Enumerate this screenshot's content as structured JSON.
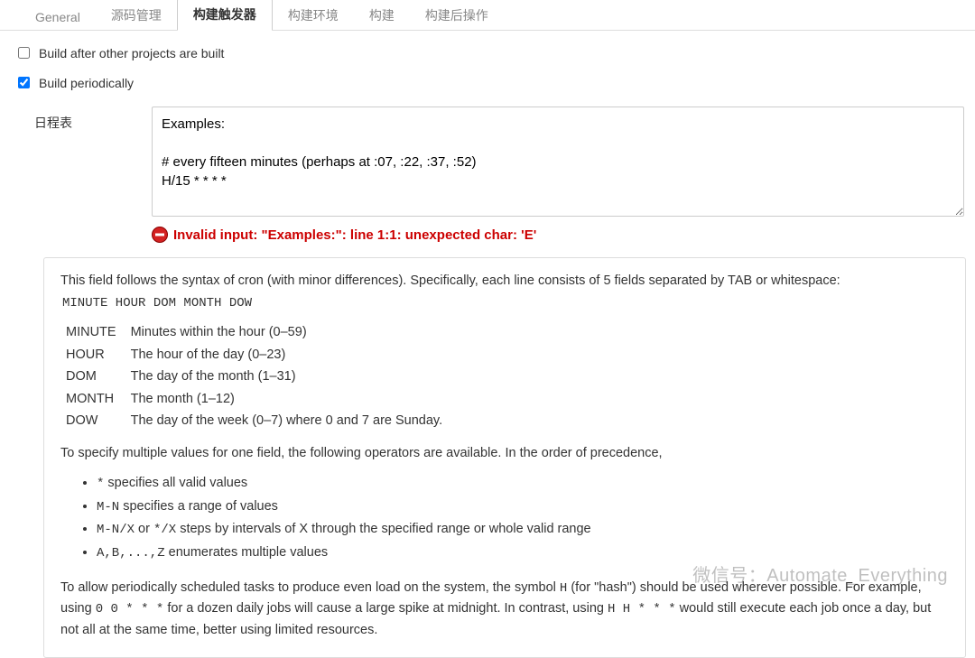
{
  "tabs": {
    "general": "General",
    "scm": "源码管理",
    "triggers": "构建触发器",
    "env": "构建环境",
    "build": "构建",
    "post": "构建后操作"
  },
  "opts": {
    "build_after": "Build after other projects are built",
    "build_periodically": "Build periodically"
  },
  "schedule": {
    "label": "日程表",
    "value": "Examples:\n\n# every fifteen minutes (perhaps at :07, :22, :37, :52)\nH/15 * * * *"
  },
  "error": {
    "text": "Invalid input: \"Examples:\": line 1:1: unexpected char: 'E'"
  },
  "help": {
    "intro": "This field follows the syntax of cron (with minor differences). Specifically, each line consists of 5 fields separated by TAB or whitespace:",
    "syntax": "MINUTE HOUR DOM MONTH DOW",
    "fields": [
      {
        "name": "MINUTE",
        "desc": "Minutes within the hour (0–59)"
      },
      {
        "name": "HOUR",
        "desc": "The hour of the day (0–23)"
      },
      {
        "name": "DOM",
        "desc": "The day of the month (1–31)"
      },
      {
        "name": "MONTH",
        "desc": "The month (1–12)"
      },
      {
        "name": "DOW",
        "desc": "The day of the week (0–7) where 0 and 7 are Sunday."
      }
    ],
    "ops_intro": "To specify multiple values for one field, the following operators are available. In the order of precedence,",
    "ops": [
      {
        "code": "*",
        "tail": " specifies all valid values"
      },
      {
        "code": "M-N",
        "tail": " specifies a range of values"
      },
      {
        "code_a": "M-N/X",
        "mid": " or ",
        "code_b": "*/X",
        "tail": " steps by intervals of X through the specified range or whole valid range"
      },
      {
        "code": "A,B,...,Z",
        "tail": " enumerates multiple values"
      }
    ],
    "hash_p1": "To allow periodically scheduled tasks to produce even load on the system, the symbol ",
    "hash_c1": "H",
    "hash_p2": " (for \"hash\") should be used wherever possible. For example, using ",
    "hash_c2": "0 0 * * *",
    "hash_p3": " for a dozen daily jobs will cause a large spike at midnight. In contrast, using ",
    "hash_c3": "H H * * *",
    "hash_p4": " would still execute each job once a day, but not all at the same time, better using limited resources."
  },
  "watermark": "微信号：Automate_Everything"
}
